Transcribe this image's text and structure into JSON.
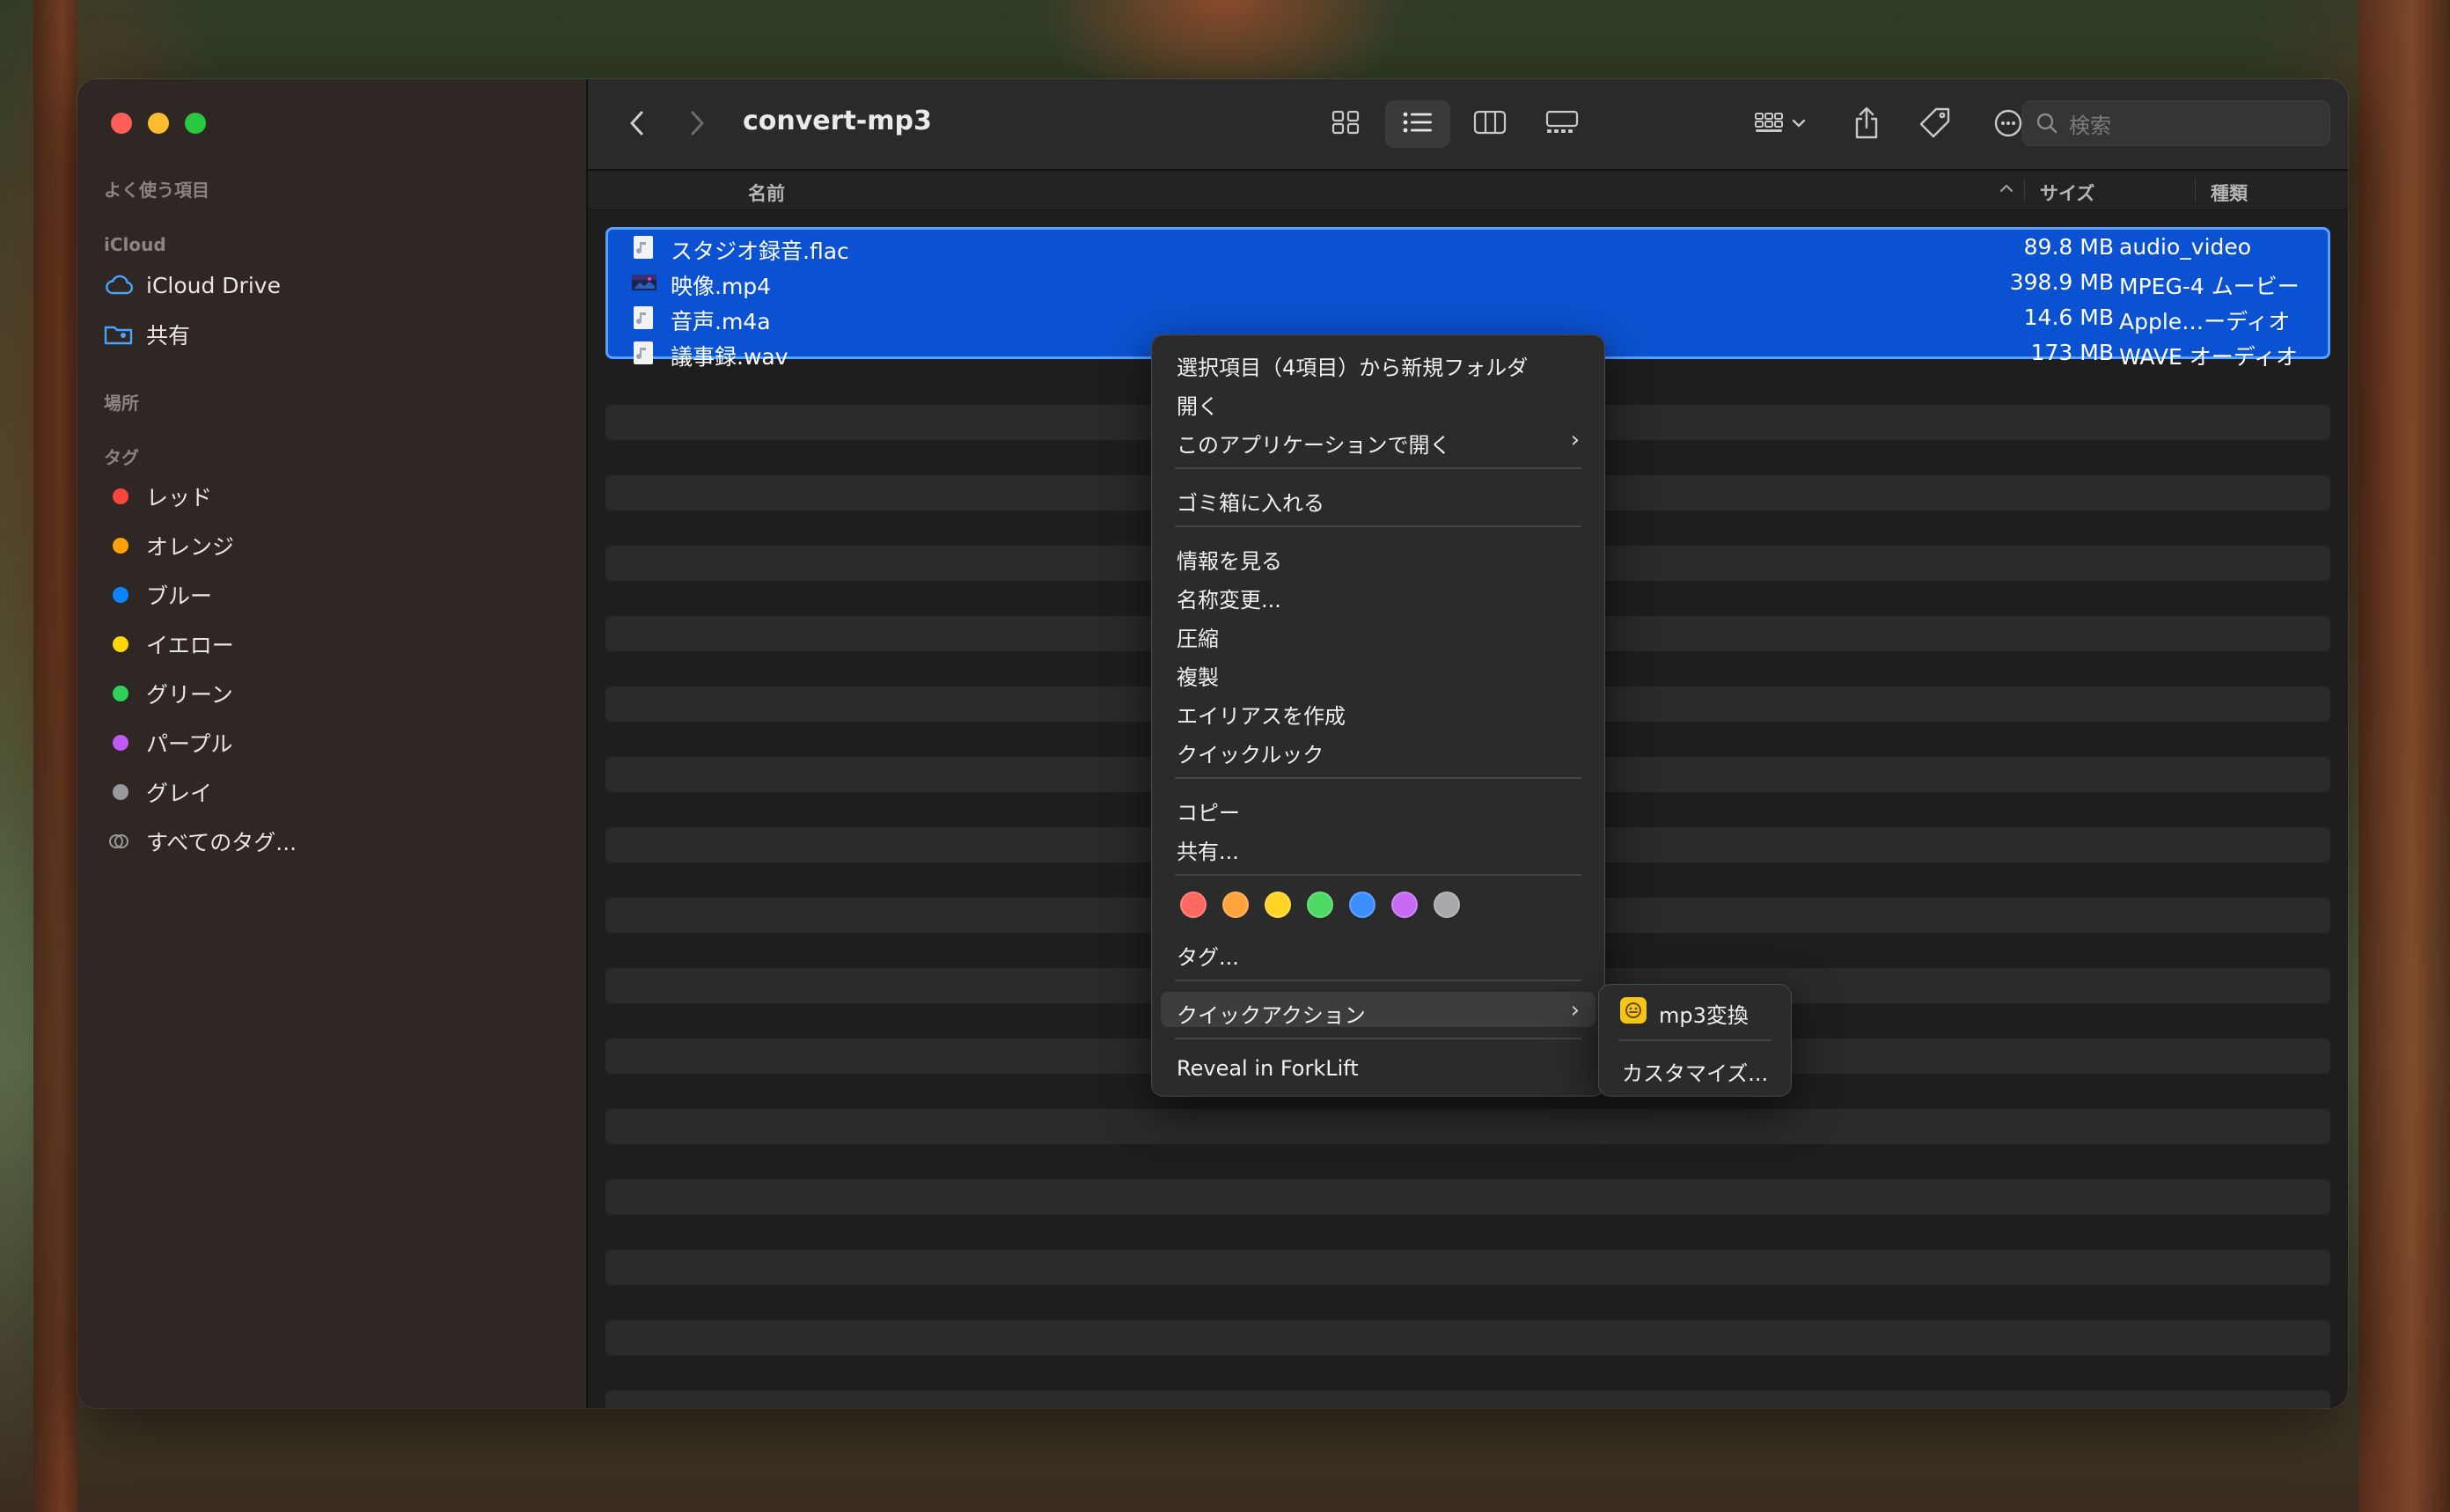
{
  "window": {
    "folder_title": "convert-mp3"
  },
  "sidebar": {
    "favorites_header": "よく使う項目",
    "icloud_header": "iCloud",
    "icloud_items": [
      {
        "label": "iCloud Drive",
        "icon": "cloud-icon"
      },
      {
        "label": "共有",
        "icon": "shared-folder-icon"
      }
    ],
    "locations_header": "場所",
    "tags_header": "タグ",
    "tags": [
      {
        "label": "レッド",
        "color": "#ff453a"
      },
      {
        "label": "オレンジ",
        "color": "#ff9f0a"
      },
      {
        "label": "ブルー",
        "color": "#0a84ff"
      },
      {
        "label": "イエロー",
        "color": "#ffd60a"
      },
      {
        "label": "グリーン",
        "color": "#30d158"
      },
      {
        "label": "パープル",
        "color": "#bf5af2"
      },
      {
        "label": "グレイ",
        "color": "#98989d"
      }
    ],
    "all_tags": "すべてのタグ..."
  },
  "toolbar": {
    "search_placeholder": "検索"
  },
  "columns": {
    "name": "名前",
    "size": "サイズ",
    "kind": "種類"
  },
  "files": [
    {
      "name": "スタジオ録音.flac",
      "size": "89.8 MB",
      "kind": "audio_video",
      "icon": "audio-file-icon"
    },
    {
      "name": "映像.mp4",
      "size": "398.9 MB",
      "kind": "MPEG-4 ムービー",
      "icon": "video-thumbnail-icon"
    },
    {
      "name": "音声.m4a",
      "size": "14.6 MB",
      "kind": "Apple…ーディオ",
      "icon": "audio-file-icon"
    },
    {
      "name": "議事録.wav",
      "size": "173 MB",
      "kind": "WAVE オーディオ",
      "icon": "audio-file-icon"
    }
  ],
  "context_menu": {
    "new_folder": "選択項目（4項目）から新規フォルダ",
    "open": "開く",
    "open_with": "このアプリケーションで開く",
    "trash": "ゴミ箱に入れる",
    "get_info": "情報を見る",
    "rename": "名称変更...",
    "compress": "圧縮",
    "duplicate": "複製",
    "make_alias": "エイリアスを作成",
    "quick_look": "クイックルック",
    "copy": "コピー",
    "share": "共有...",
    "tag_colors": [
      "#ff6961",
      "#ffa33a",
      "#ffd426",
      "#4cd964",
      "#3d8eff",
      "#c76bf7",
      "#a8a8ad"
    ],
    "tags": "タグ...",
    "quick_actions": "クイックアクション",
    "reveal": "Reveal in ForkLift"
  },
  "submenu": {
    "mp3_convert": "mp3変換",
    "customize": "カスタマイズ..."
  }
}
